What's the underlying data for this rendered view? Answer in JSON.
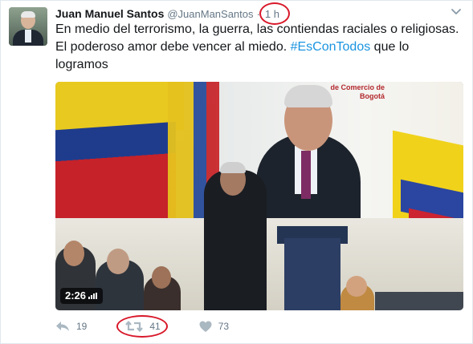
{
  "tweet": {
    "author_name": "Juan Manuel Santos",
    "handle": "@JuanManSantos",
    "separator": "·",
    "time": "1 h",
    "text_part1": "En medio del terrorismo, la guerra, las contiendas raciales o religiosas. El poderoso amor debe vencer al miedo. ",
    "hashtag": "#EsConTodos",
    "text_part2": " que lo logramos"
  },
  "media": {
    "duration": "2:26",
    "screen_text": "de Comercio de Bogotá"
  },
  "actions": {
    "reply_count": "19",
    "retweet_count": "41",
    "like_count": "73"
  },
  "colors": {
    "hashtag": "#1b95e0",
    "secondary": "#657786",
    "annotation": "#d8182a"
  }
}
